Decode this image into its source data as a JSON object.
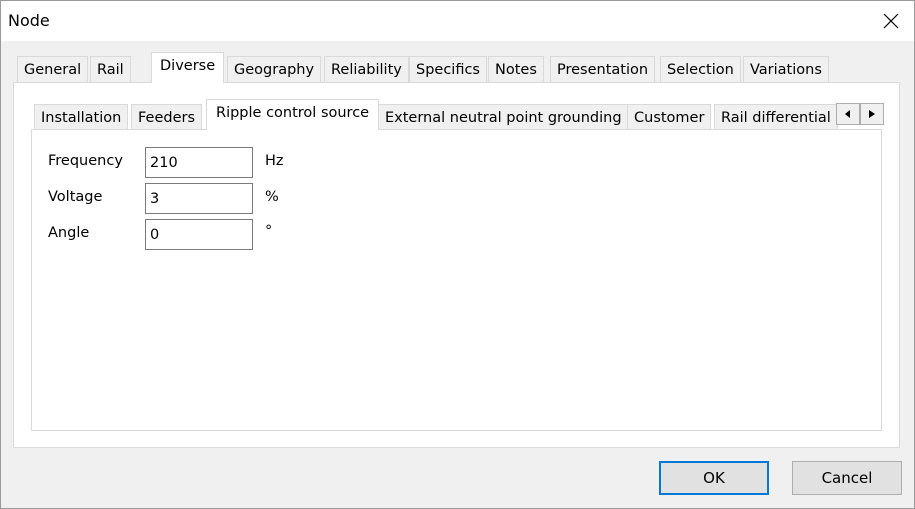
{
  "window": {
    "title": "Node"
  },
  "main_tabs": [
    "General",
    "Rail",
    "Diverse",
    "Geography",
    "Reliability",
    "Specifics",
    "Notes",
    "Presentation",
    "Selection",
    "Variations"
  ],
  "sub_tabs": [
    "Installation",
    "Feeders",
    "Ripple control source",
    "External neutral point grounding",
    "Customer",
    "Rail differential"
  ],
  "form": {
    "frequency": {
      "label": "Frequency",
      "value": "210",
      "unit": "Hz"
    },
    "voltage": {
      "label": "Voltage",
      "value": "3",
      "unit": "%"
    },
    "angle": {
      "label": "Angle",
      "value": "0",
      "unit": "°"
    }
  },
  "buttons": {
    "ok": "OK",
    "cancel": "Cancel"
  }
}
